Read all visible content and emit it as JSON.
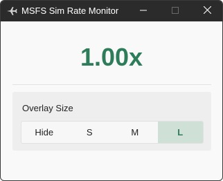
{
  "window": {
    "title": "MSFS Sim Rate Monitor",
    "icons": {
      "app": "airplane-icon",
      "minimize": "minimize-icon",
      "maximize": "maximize-icon",
      "close": "close-icon"
    }
  },
  "main": {
    "sim_rate": "1.00x",
    "overlay": {
      "label": "Overlay Size",
      "options": [
        {
          "label": "Hide",
          "selected": false
        },
        {
          "label": "S",
          "selected": false
        },
        {
          "label": "M",
          "selected": false
        },
        {
          "label": "L",
          "selected": true
        }
      ]
    }
  },
  "colors": {
    "accent": "#2e7d5a",
    "selected_bg": "#cfe0d6",
    "titlebar_bg": "#2b2b2b"
  }
}
